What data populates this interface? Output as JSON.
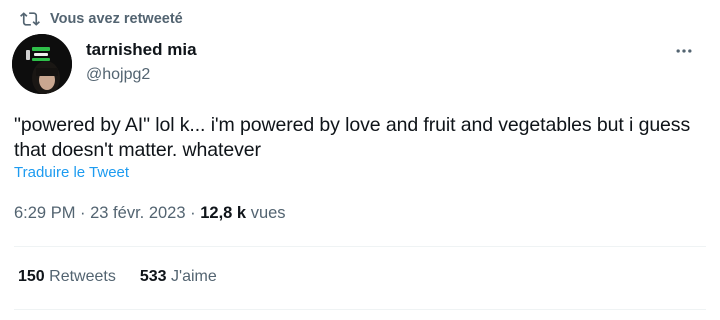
{
  "retweet_banner": {
    "label": "Vous avez retweeté",
    "icon": "retweet-icon"
  },
  "author": {
    "display_name": "tarnished mia",
    "handle": "@hojpg2",
    "avatar": "avatar"
  },
  "more_menu": {
    "icon": "more-horizontal-icon"
  },
  "tweet": {
    "text": "\"powered by AI\" lol k... i'm powered by love and fruit and vegetables but i guess that doesn't matter. whatever",
    "translate_link": "Traduire le Tweet"
  },
  "meta": {
    "time": "6:29 PM",
    "separator": " · ",
    "date": "23 févr. 2023",
    "views_count": "12,8 k",
    "views_label": "vues"
  },
  "stats": {
    "retweets_count": "150",
    "retweets_label": "Retweets",
    "likes_count": "533",
    "likes_label": "J'aime"
  },
  "colors": {
    "text_primary": "#0f1419",
    "text_secondary": "#536471",
    "link": "#1d9bf0",
    "divider": "#eff3f4"
  }
}
